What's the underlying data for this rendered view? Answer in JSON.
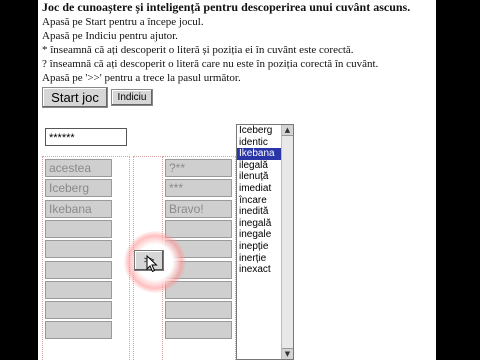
{
  "header": {
    "title": "Joc de cunoaștere și inteligență pentru descoperirea unui cuvânt ascuns.",
    "lines": [
      "Apasă pe Start pentru a începe jocul.",
      "Apasă pe Indiciu pentru ajutor.",
      "* înseamnă că ați descoperit o literă și poziția ei în cuvânt este corectă.",
      "? înseamnă că ați descoperit o literă care nu este în poziția corectă în cuvânt.",
      "Apasă pe '>>' pentru a trece la pasul următor."
    ]
  },
  "buttons": {
    "start_label": "Start joc",
    "hint_label": "Indiciu",
    "next_label": ">>"
  },
  "password_field": {
    "value": "******"
  },
  "guesses": [
    "acestea",
    "Iceberg",
    "Ikebana",
    "",
    "",
    "",
    "",
    "",
    ""
  ],
  "results": [
    "?**",
    "***",
    "Bravo!",
    "",
    "",
    "",
    "",
    "",
    ""
  ],
  "word_list": {
    "items": [
      "Iceberg",
      "identic",
      "Ikebana",
      "ilegală",
      "ilenuță",
      "imediat",
      "încare",
      "inedită",
      "inegală",
      "inegale",
      "inepție",
      "inerție",
      "inexact"
    ],
    "selected": "Ikebana"
  },
  "colors": {
    "selection": "#2a35a8",
    "cell_bg": "#cfcfcf"
  }
}
